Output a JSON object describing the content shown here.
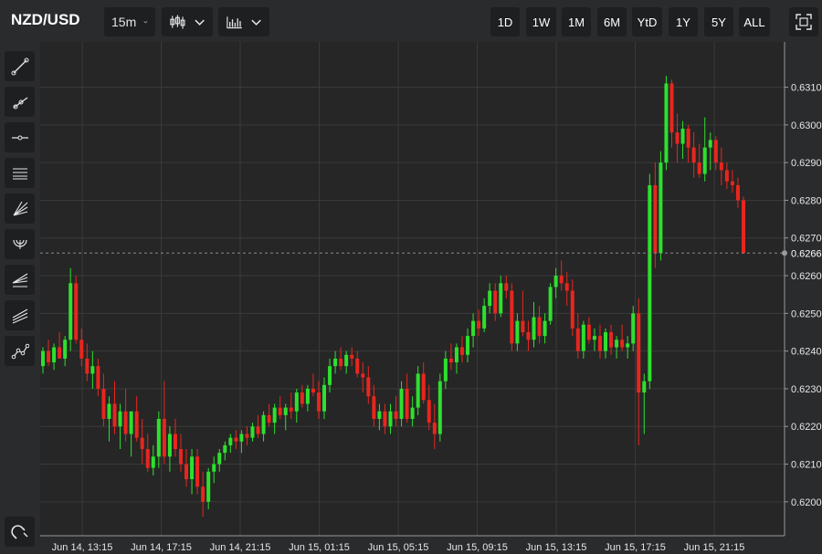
{
  "header": {
    "symbol": "NZD/USD",
    "interval": "15m",
    "chart_type_icon": "candlestick-icon",
    "indicators_icon": "bar-chart-icon",
    "ranges": [
      "1D",
      "1W",
      "1M",
      "6M",
      "YtD",
      "1Y",
      "5Y",
      "ALL"
    ],
    "fullscreen_icon": "fullscreen-icon"
  },
  "sidebar": {
    "tools": [
      "trend-line-icon",
      "ray-icon",
      "horizontal-line-icon",
      "channel-icon",
      "fan-icon",
      "arc-icon",
      "fib-retracement-icon",
      "parallel-lines-icon",
      "path-icon"
    ],
    "bottom_tool": "magnet-icon"
  },
  "colors": {
    "background": "#2a2b2d",
    "plot_background": "#262626",
    "up": "#2ee02e",
    "down": "#e8261e",
    "grid": "#3a3a3a"
  },
  "chart_data": {
    "type": "candlestick",
    "interval": "15m",
    "last_price": "0.6266",
    "ylim": [
      0.6191,
      0.6322
    ],
    "yticks": [
      "0.6200",
      "0.6210",
      "0.6220",
      "0.6230",
      "0.6240",
      "0.6250",
      "0.6260",
      "0.6270",
      "0.6280",
      "0.6290",
      "0.6300",
      "0.6310"
    ],
    "xticks": [
      "Jun 14, 13:15",
      "Jun 14, 17:15",
      "Jun 14, 21:15",
      "Jun 15, 01:15",
      "Jun 15, 05:15",
      "Jun 15, 09:15",
      "Jun 15, 13:15",
      "Jun 15, 17:15",
      "Jun 15, 21:15"
    ],
    "candles": [
      [
        0.6236,
        0.6241,
        0.6234,
        0.624
      ],
      [
        0.624,
        0.6243,
        0.6236,
        0.6237
      ],
      [
        0.6237,
        0.6242,
        0.6235,
        0.6241
      ],
      [
        0.6241,
        0.6245,
        0.6238,
        0.6238
      ],
      [
        0.6238,
        0.6244,
        0.6236,
        0.6243
      ],
      [
        0.6243,
        0.6262,
        0.624,
        0.6258
      ],
      [
        0.6258,
        0.626,
        0.6242,
        0.6243
      ],
      [
        0.6243,
        0.6246,
        0.6236,
        0.6238
      ],
      [
        0.6238,
        0.6242,
        0.6232,
        0.6234
      ],
      [
        0.6234,
        0.624,
        0.623,
        0.6236
      ],
      [
        0.6236,
        0.6238,
        0.6228,
        0.623
      ],
      [
        0.623,
        0.6234,
        0.622,
        0.6222
      ],
      [
        0.6222,
        0.6228,
        0.6216,
        0.6226
      ],
      [
        0.6226,
        0.6232,
        0.6218,
        0.622
      ],
      [
        0.622,
        0.6226,
        0.6214,
        0.6224
      ],
      [
        0.6224,
        0.623,
        0.6216,
        0.6218
      ],
      [
        0.6218,
        0.6224,
        0.6212,
        0.6224
      ],
      [
        0.6224,
        0.6228,
        0.6216,
        0.6217
      ],
      [
        0.6217,
        0.6222,
        0.621,
        0.6214
      ],
      [
        0.6214,
        0.6218,
        0.6208,
        0.6209
      ],
      [
        0.6209,
        0.6215,
        0.6207,
        0.6212
      ],
      [
        0.6212,
        0.6224,
        0.6209,
        0.6222
      ],
      [
        0.6222,
        0.6232,
        0.621,
        0.6212
      ],
      [
        0.6212,
        0.622,
        0.6208,
        0.6218
      ],
      [
        0.6218,
        0.6222,
        0.6212,
        0.6214
      ],
      [
        0.6214,
        0.6218,
        0.6208,
        0.621
      ],
      [
        0.621,
        0.6214,
        0.6204,
        0.6206
      ],
      [
        0.6206,
        0.6214,
        0.6202,
        0.6212
      ],
      [
        0.6212,
        0.6214,
        0.6202,
        0.6204
      ],
      [
        0.6204,
        0.6208,
        0.6196,
        0.62
      ],
      [
        0.62,
        0.6209,
        0.6198,
        0.6208
      ],
      [
        0.6208,
        0.6212,
        0.6205,
        0.621
      ],
      [
        0.621,
        0.6214,
        0.6208,
        0.6213
      ],
      [
        0.6213,
        0.6216,
        0.6211,
        0.6215
      ],
      [
        0.6215,
        0.6218,
        0.6213,
        0.6217
      ],
      [
        0.6217,
        0.6219,
        0.6214,
        0.6216
      ],
      [
        0.6216,
        0.6219,
        0.6213,
        0.6218
      ],
      [
        0.6218,
        0.622,
        0.6215,
        0.6217
      ],
      [
        0.6217,
        0.6221,
        0.6216,
        0.622
      ],
      [
        0.622,
        0.6223,
        0.6217,
        0.6218
      ],
      [
        0.6218,
        0.6224,
        0.6216,
        0.6223
      ],
      [
        0.6223,
        0.6226,
        0.622,
        0.6221
      ],
      [
        0.6221,
        0.6226,
        0.6218,
        0.6225
      ],
      [
        0.6225,
        0.6228,
        0.6222,
        0.6223
      ],
      [
        0.6223,
        0.6226,
        0.6219,
        0.6225
      ],
      [
        0.6225,
        0.6229,
        0.6222,
        0.6224
      ],
      [
        0.6224,
        0.623,
        0.6221,
        0.6229
      ],
      [
        0.6229,
        0.6231,
        0.6225,
        0.6226
      ],
      [
        0.6226,
        0.6231,
        0.6224,
        0.623
      ],
      [
        0.623,
        0.6234,
        0.6228,
        0.6229
      ],
      [
        0.6229,
        0.6232,
        0.6222,
        0.6224
      ],
      [
        0.6224,
        0.6233,
        0.6222,
        0.6231
      ],
      [
        0.6231,
        0.6238,
        0.6229,
        0.6236
      ],
      [
        0.6236,
        0.624,
        0.6234,
        0.6238
      ],
      [
        0.6238,
        0.6241,
        0.6235,
        0.6236
      ],
      [
        0.6236,
        0.624,
        0.6234,
        0.6239
      ],
      [
        0.6239,
        0.6241,
        0.6236,
        0.6238
      ],
      [
        0.6238,
        0.624,
        0.6233,
        0.6234
      ],
      [
        0.6234,
        0.6237,
        0.6229,
        0.6233
      ],
      [
        0.6233,
        0.6236,
        0.6226,
        0.6228
      ],
      [
        0.6228,
        0.6231,
        0.622,
        0.6222
      ],
      [
        0.6222,
        0.6226,
        0.6219,
        0.6224
      ],
      [
        0.6224,
        0.6226,
        0.6218,
        0.622
      ],
      [
        0.622,
        0.6226,
        0.6218,
        0.6224
      ],
      [
        0.6224,
        0.6228,
        0.622,
        0.6222
      ],
      [
        0.6222,
        0.6232,
        0.622,
        0.623
      ],
      [
        0.623,
        0.6234,
        0.6221,
        0.6222
      ],
      [
        0.6222,
        0.6228,
        0.622,
        0.6225
      ],
      [
        0.6225,
        0.6236,
        0.6223,
        0.6234
      ],
      [
        0.6234,
        0.6237,
        0.6226,
        0.6227
      ],
      [
        0.6227,
        0.6231,
        0.6219,
        0.6221
      ],
      [
        0.6221,
        0.6226,
        0.6214,
        0.6218
      ],
      [
        0.6218,
        0.6234,
        0.6216,
        0.6232
      ],
      [
        0.6232,
        0.624,
        0.623,
        0.6238
      ],
      [
        0.6238,
        0.6242,
        0.6235,
        0.6237
      ],
      [
        0.6237,
        0.6242,
        0.6234,
        0.6241
      ],
      [
        0.6241,
        0.6244,
        0.6237,
        0.6239
      ],
      [
        0.6239,
        0.6246,
        0.6237,
        0.6244
      ],
      [
        0.6244,
        0.625,
        0.6241,
        0.6248
      ],
      [
        0.6248,
        0.6251,
        0.6244,
        0.6246
      ],
      [
        0.6246,
        0.6254,
        0.6245,
        0.6252
      ],
      [
        0.6252,
        0.6258,
        0.625,
        0.6256
      ],
      [
        0.6256,
        0.6258,
        0.6248,
        0.625
      ],
      [
        0.625,
        0.626,
        0.6249,
        0.6258
      ],
      [
        0.6258,
        0.626,
        0.6254,
        0.6256
      ],
      [
        0.6256,
        0.6258,
        0.624,
        0.6242
      ],
      [
        0.6242,
        0.625,
        0.624,
        0.6248
      ],
      [
        0.6248,
        0.6256,
        0.6244,
        0.6245
      ],
      [
        0.6245,
        0.6248,
        0.624,
        0.6243
      ],
      [
        0.6243,
        0.6253,
        0.6241,
        0.6249
      ],
      [
        0.6249,
        0.6252,
        0.6242,
        0.6244
      ],
      [
        0.6244,
        0.625,
        0.6242,
        0.6248
      ],
      [
        0.6248,
        0.6258,
        0.6247,
        0.6257
      ],
      [
        0.6257,
        0.6262,
        0.6254,
        0.626
      ],
      [
        0.626,
        0.6264,
        0.6256,
        0.6258
      ],
      [
        0.6258,
        0.6261,
        0.6252,
        0.6256
      ],
      [
        0.6256,
        0.6259,
        0.6244,
        0.6246
      ],
      [
        0.6246,
        0.625,
        0.6238,
        0.624
      ],
      [
        0.624,
        0.6248,
        0.6238,
        0.6247
      ],
      [
        0.6247,
        0.6249,
        0.6242,
        0.6243
      ],
      [
        0.6243,
        0.6246,
        0.624,
        0.6244
      ],
      [
        0.6244,
        0.6247,
        0.6238,
        0.624
      ],
      [
        0.624,
        0.6246,
        0.6238,
        0.6245
      ],
      [
        0.6245,
        0.6247,
        0.6239,
        0.6241
      ],
      [
        0.6241,
        0.6244,
        0.6238,
        0.6243
      ],
      [
        0.6243,
        0.6247,
        0.624,
        0.6241
      ],
      [
        0.6241,
        0.6244,
        0.6238,
        0.6242
      ],
      [
        0.6242,
        0.6252,
        0.624,
        0.625
      ],
      [
        0.625,
        0.6254,
        0.6215,
        0.6229
      ],
      [
        0.6229,
        0.6234,
        0.6218,
        0.6232
      ],
      [
        0.6232,
        0.6287,
        0.623,
        0.6284
      ],
      [
        0.6284,
        0.629,
        0.6262,
        0.6266
      ],
      [
        0.6266,
        0.6293,
        0.6264,
        0.629
      ],
      [
        0.629,
        0.6313,
        0.6288,
        0.6311
      ],
      [
        0.6311,
        0.6312,
        0.6294,
        0.6298
      ],
      [
        0.6298,
        0.6303,
        0.629,
        0.6295
      ],
      [
        0.6295,
        0.6301,
        0.6291,
        0.6299
      ],
      [
        0.6299,
        0.63,
        0.629,
        0.6294
      ],
      [
        0.6294,
        0.6298,
        0.6286,
        0.629
      ],
      [
        0.629,
        0.6295,
        0.6286,
        0.6287
      ],
      [
        0.6287,
        0.6302,
        0.6285,
        0.6294
      ],
      [
        0.6294,
        0.6298,
        0.6288,
        0.6296
      ],
      [
        0.6296,
        0.6297,
        0.6288,
        0.629
      ],
      [
        0.629,
        0.6294,
        0.6284,
        0.6288
      ],
      [
        0.6288,
        0.629,
        0.6283,
        0.6285
      ],
      [
        0.6285,
        0.6288,
        0.6282,
        0.6284
      ],
      [
        0.6284,
        0.6286,
        0.6278,
        0.628
      ],
      [
        0.628,
        0.6281,
        0.6266,
        0.6266
      ]
    ]
  }
}
